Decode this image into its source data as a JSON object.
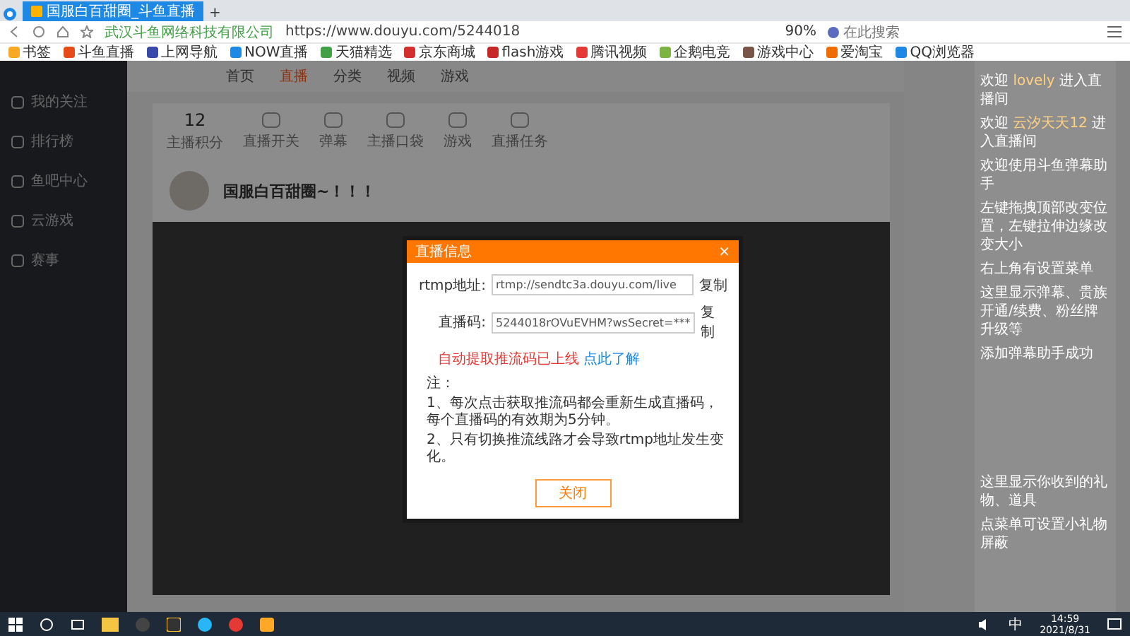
{
  "browser": {
    "tab_title": "国服白百甜圈_斗鱼直播",
    "new_tab": "+",
    "site_owner": "武汉斗鱼网络科技有限公司",
    "url": "https://www.douyu.com/5244018",
    "zoom": "90%",
    "search_placeholder": "在此搜索",
    "bookmarks": [
      "书签",
      "斗鱼直播",
      "上网导航",
      "NOW直播",
      "天猫精选",
      "京东商城",
      "flash游戏",
      "腾讯视频",
      "企鹅电竞",
      "游戏中心",
      "爱淘宝",
      "QQ浏览器"
    ]
  },
  "site": {
    "nav": [
      {
        "label": "首页",
        "selected": false
      },
      {
        "label": "直播",
        "selected": true
      },
      {
        "label": "分类",
        "selected": false
      },
      {
        "label": "视频",
        "selected": false
      },
      {
        "label": "游戏",
        "selected": false
      }
    ]
  },
  "sidebar": {
    "items": [
      "我的关注",
      "排行榜",
      "鱼吧中心",
      "云游戏",
      "赛事"
    ]
  },
  "toolbar": {
    "points": "12",
    "items": [
      "主播积分",
      "直播开关",
      "弹幕",
      "主播口袋",
      "游戏",
      "直播任务"
    ]
  },
  "streamer": {
    "name": "国服白百甜圈~！！！"
  },
  "dialog": {
    "title": "直播信息",
    "close": "×",
    "fields": [
      {
        "label": "rtmp地址:",
        "value": "rtmp://sendtc3a.douyu.com/live",
        "copy": "复制"
      },
      {
        "label": "直播码:",
        "value": "5244018rOVuEVHM?wsSecret=***",
        "copy": "复制"
      }
    ],
    "warning": "自动提取推流码已上线",
    "link": "点此了解",
    "notes": [
      "注：",
      "1、每次点击获取推流码都会重新生成直播码，每个直播码的有效期为5分钟。",
      "2、只有切换推流线路才会导致rtmp地址发生变化。"
    ],
    "button": "关闭"
  },
  "chat_overlay": {
    "messages": [
      {
        "kind": "welcome",
        "prefix": "欢迎",
        "user": "lovely",
        "text": "进入直播间"
      },
      {
        "kind": "welcome",
        "prefix": "欢迎",
        "user": "云汐天天12",
        "text": "进入直播间"
      },
      {
        "kind": "system",
        "text": "欢迎使用斗鱼弹幕助手"
      },
      {
        "kind": "system",
        "text": "左键拖拽顶部改变位置，左键拉伸边缘改变大小"
      },
      {
        "kind": "system",
        "text": "右上角有设置菜单"
      },
      {
        "kind": "system",
        "text": "这里显示弹幕、贵族开通/续费、粉丝牌升级等"
      },
      {
        "kind": "system",
        "text": "添加弹幕助手成功"
      },
      {
        "kind": "gap"
      },
      {
        "kind": "system",
        "text": "这里显示你收到的礼物、道具"
      },
      {
        "kind": "system",
        "text": "点菜单可设置小礼物屏蔽"
      }
    ]
  },
  "taskbar": {
    "ime": "中",
    "time": "14:59",
    "date": "2021/8/31"
  }
}
